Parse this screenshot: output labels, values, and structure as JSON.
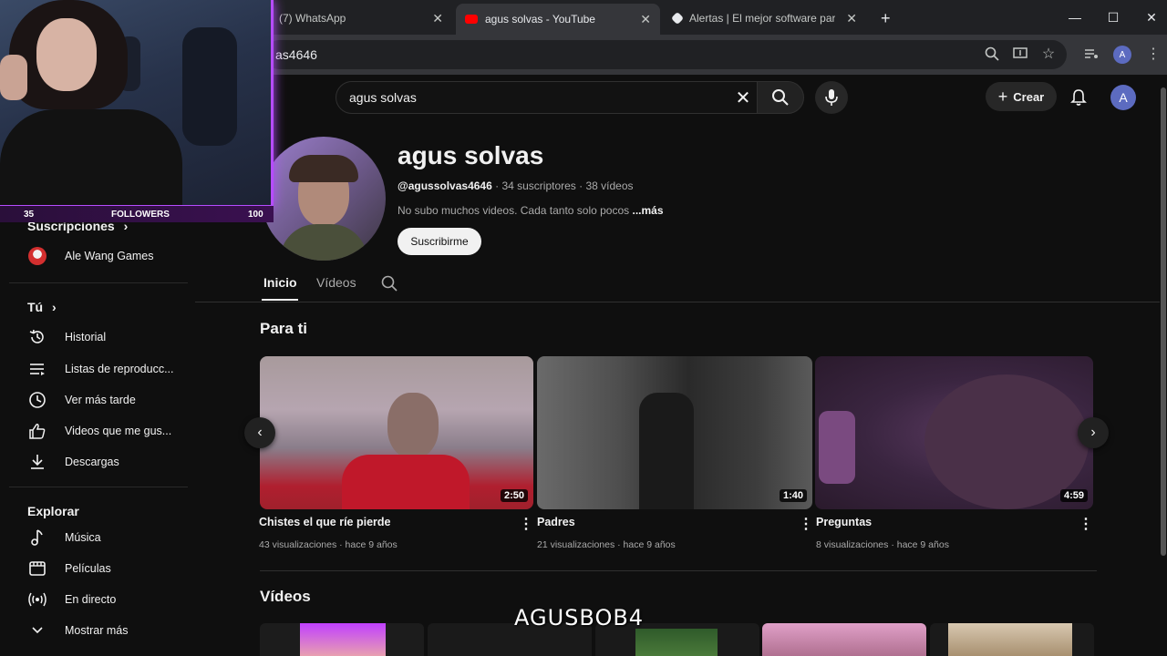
{
  "browser": {
    "tabs": [
      {
        "title": "(7) WhatsApp",
        "active": false
      },
      {
        "title": "agus solvas - YouTube",
        "active": true
      },
      {
        "title": "Alertas | El mejor software para",
        "active": false
      }
    ],
    "new_tab": "+",
    "url": "as4646",
    "profile_letter": "A"
  },
  "header": {
    "search_query": "agus solvas",
    "create_label": "Crear",
    "avatar_letter": "A"
  },
  "overlay": {
    "followers_current": "35",
    "followers_label": "FOLLOWERS",
    "followers_goal": "100",
    "watermark": "AGUSBOB4",
    "accent": "#b64cff"
  },
  "sidebar": {
    "subscriptions_heading": "Suscripciones",
    "subscriptions": [
      {
        "label": "Ale Wang Games"
      }
    ],
    "you_heading": "Tú",
    "you_items": [
      {
        "label": "Historial",
        "icon": "history-icon"
      },
      {
        "label": "Listas de reproducc...",
        "icon": "playlist-icon"
      },
      {
        "label": "Ver más tarde",
        "icon": "clock-icon"
      },
      {
        "label": "Videos que me gus...",
        "icon": "thumbs-up-icon"
      },
      {
        "label": "Descargas",
        "icon": "download-icon"
      }
    ],
    "explore_heading": "Explorar",
    "explore_items": [
      {
        "label": "Música",
        "icon": "music-icon"
      },
      {
        "label": "Películas",
        "icon": "film-icon"
      },
      {
        "label": "En directo",
        "icon": "live-icon"
      },
      {
        "label": "Mostrar más",
        "icon": "chevron-down-icon"
      }
    ]
  },
  "channel": {
    "name": "agus solvas",
    "handle": "@agussolvas4646",
    "subscribers": "· 34 suscriptores",
    "videos_count": "· 38 vídeos",
    "description": "No subo muchos videos. Cada tanto solo pocos",
    "more": "...más",
    "subscribe_label": "Suscribirme"
  },
  "tabs": [
    {
      "label": "Inicio",
      "active": true
    },
    {
      "label": "Vídeos",
      "active": false
    }
  ],
  "for_you": {
    "heading": "Para ti",
    "videos": [
      {
        "title": "Chistes el que ríe pierde",
        "views": "43 visualizaciones",
        "age": "· hace 9 años",
        "duration": "2:50"
      },
      {
        "title": "Padres",
        "views": "21 visualizaciones",
        "age": "· hace 9 años",
        "duration": "1:40"
      },
      {
        "title": "Preguntas",
        "views": "8 visualizaciones",
        "age": "· hace 9 años",
        "duration": "4:59"
      }
    ]
  },
  "videos_section": {
    "heading": "Vídeos"
  }
}
